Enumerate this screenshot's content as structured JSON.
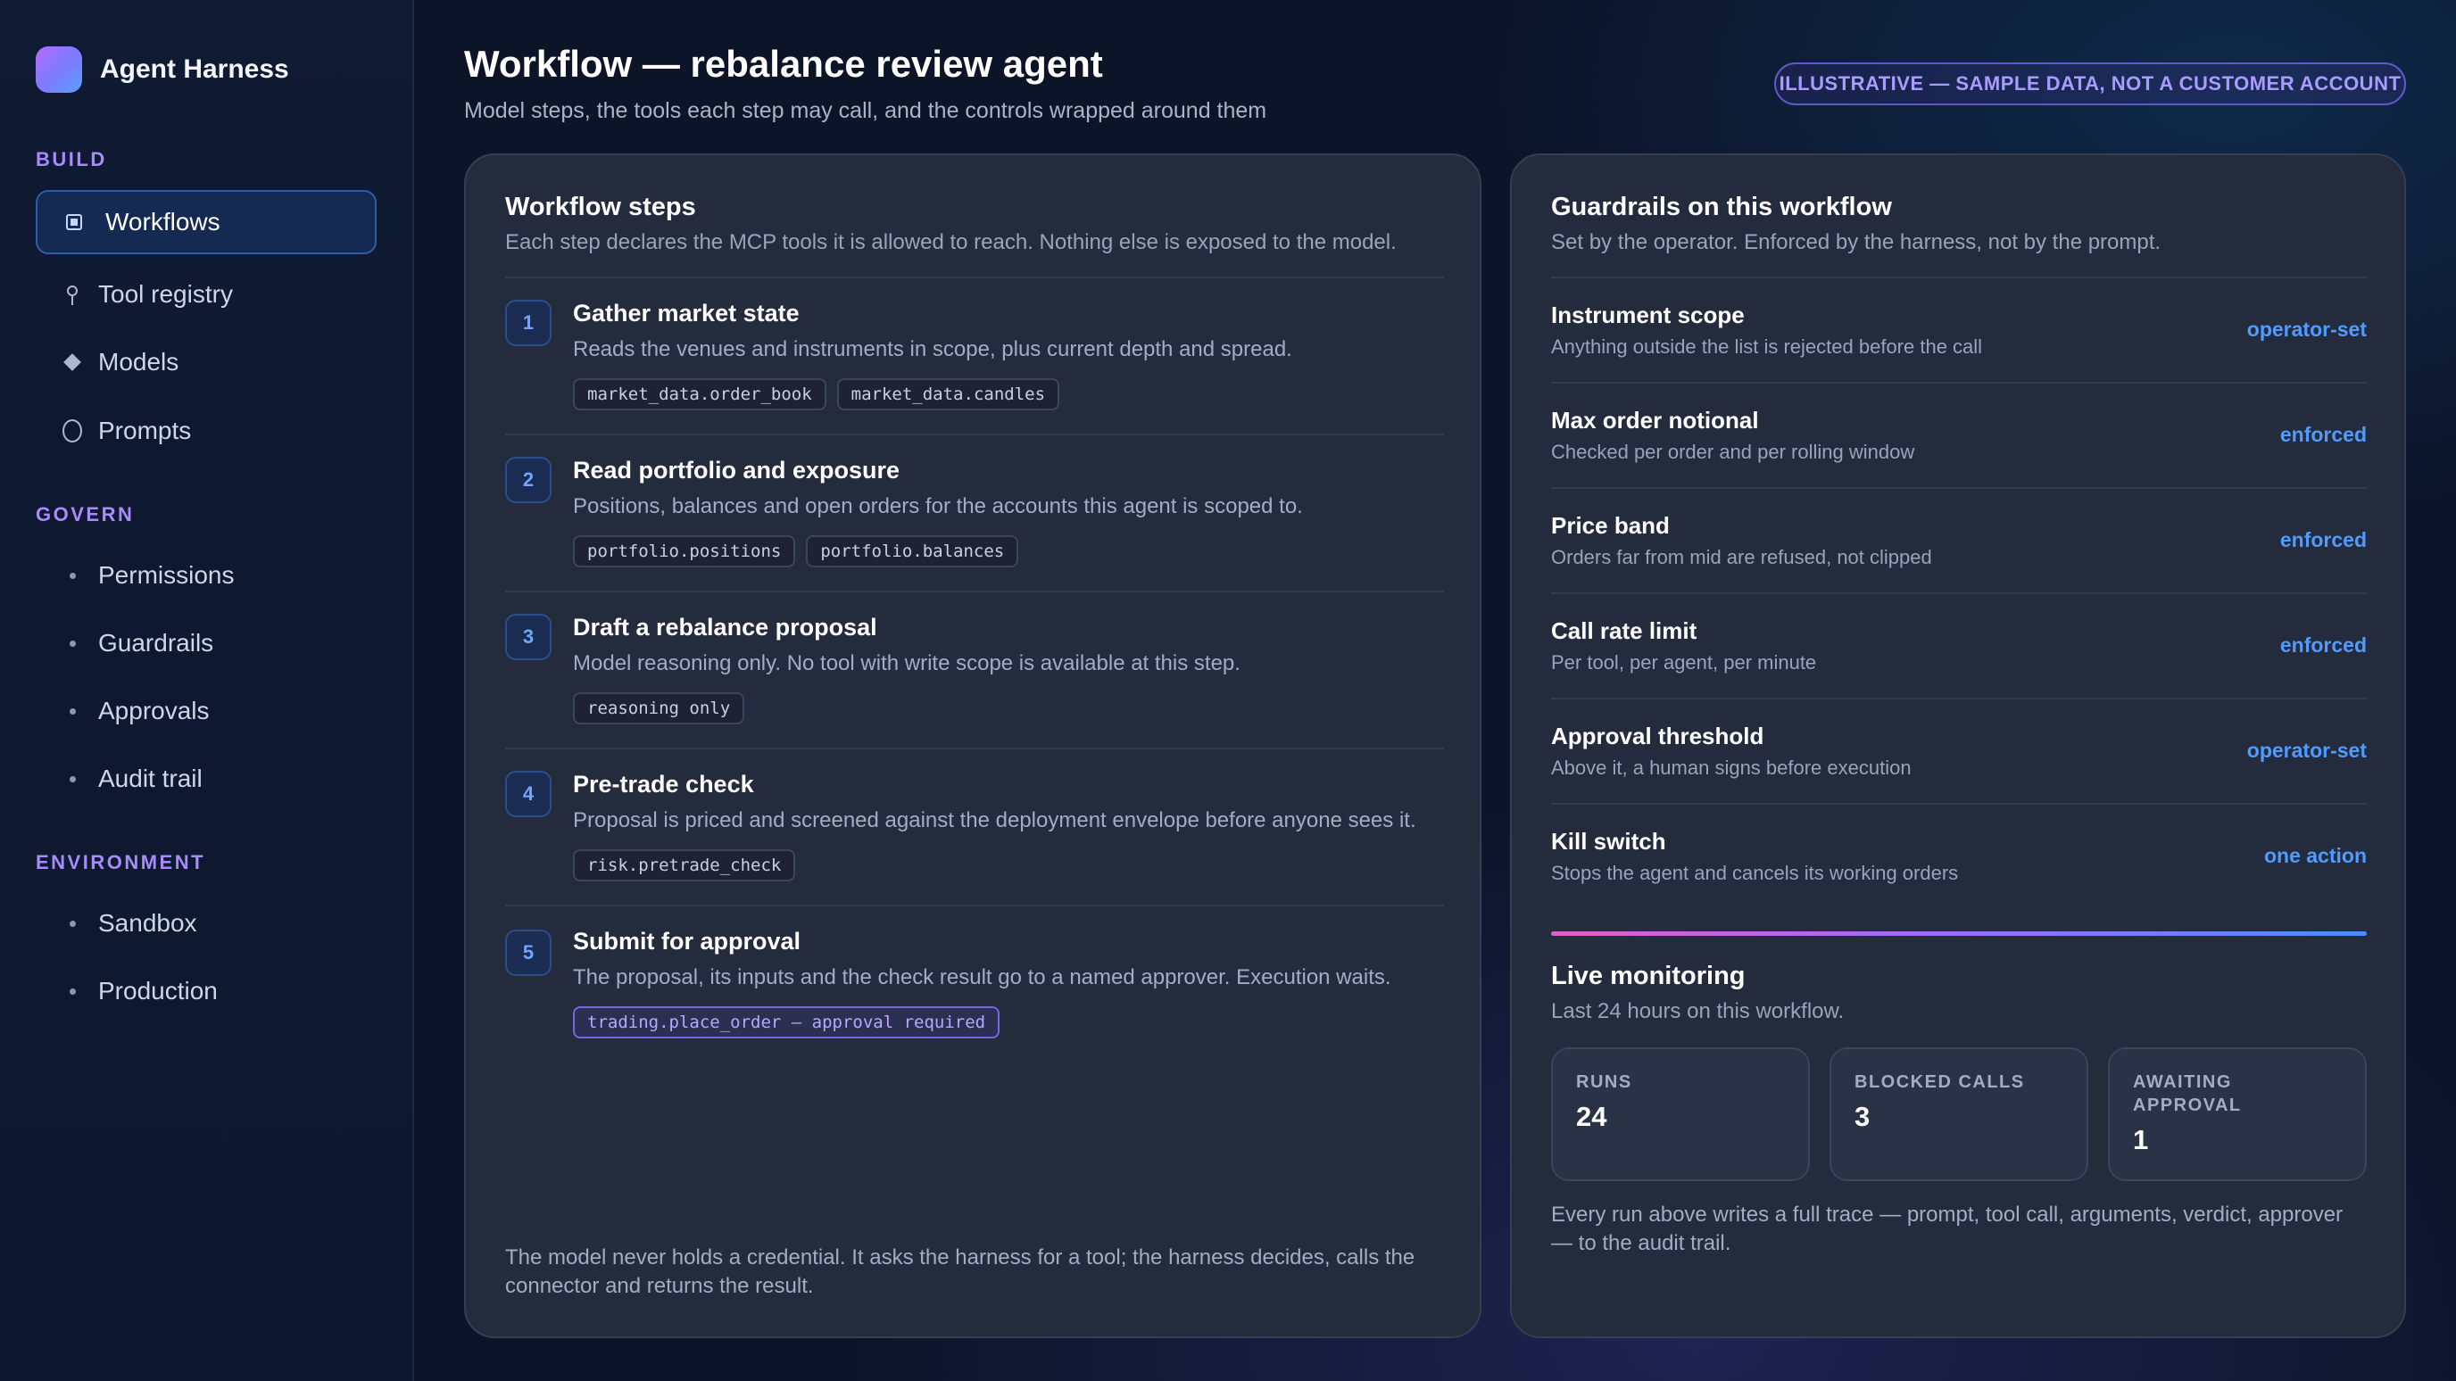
{
  "app": {
    "name": "Agent Harness"
  },
  "sidebar": {
    "sections": [
      {
        "label": "BUILD",
        "items": [
          {
            "label": "Workflows",
            "icon": "workflow-square-icon",
            "active": true
          },
          {
            "label": "Tool registry",
            "icon": "pin-icon"
          },
          {
            "label": "Models",
            "icon": "diamond-icon"
          },
          {
            "label": "Prompts",
            "icon": "circle-icon"
          }
        ]
      },
      {
        "label": "GOVERN",
        "items": [
          {
            "label": "Permissions",
            "icon": "dot-icon"
          },
          {
            "label": "Guardrails",
            "icon": "dot-icon"
          },
          {
            "label": "Approvals",
            "icon": "dot-icon"
          },
          {
            "label": "Audit trail",
            "icon": "dot-icon"
          }
        ]
      },
      {
        "label": "ENVIRONMENT",
        "items": [
          {
            "label": "Sandbox",
            "icon": "dot-icon"
          },
          {
            "label": "Production",
            "icon": "dot-icon"
          }
        ]
      }
    ]
  },
  "header": {
    "title": "Workflow — rebalance review agent",
    "subtitle": "Model steps, the tools each step may call, and the controls wrapped around them",
    "badge": "ILLUSTRATIVE — SAMPLE DATA, NOT A CUSTOMER ACCOUNT"
  },
  "workflow": {
    "title": "Workflow steps",
    "description": "Each step declares the MCP tools it is allowed to reach. Nothing else is exposed to the model.",
    "steps": [
      {
        "number": "1",
        "title": "Gather market state",
        "description": "Reads the venues and instruments in scope, plus current depth and spread.",
        "tools": [
          "market_data.order_book",
          "market_data.candles"
        ]
      },
      {
        "number": "2",
        "title": "Read portfolio and exposure",
        "description": "Positions, balances and open orders for the accounts this agent is scoped to.",
        "tools": [
          "portfolio.positions",
          "portfolio.balances"
        ]
      },
      {
        "number": "3",
        "title": "Draft a rebalance proposal",
        "description": "Model reasoning only. No tool with write scope is available at this step.",
        "tools": [
          "reasoning only"
        ]
      },
      {
        "number": "4",
        "title": "Pre-trade check",
        "description": "Proposal is priced and screened against the deployment envelope before anyone sees it.",
        "tools": [
          "risk.pretrade_check"
        ]
      },
      {
        "number": "5",
        "title": "Submit for approval",
        "description": "The proposal, its inputs and the check result go to a named approver. Execution waits.",
        "tools": [
          "trading.place_order — approval required"
        ]
      }
    ],
    "footer": "The model never holds a credential. It asks the harness for a tool; the harness decides, calls the connector and returns the result."
  },
  "guardrails": {
    "title": "Guardrails on this workflow",
    "description": "Set by the operator. Enforced by the harness, not by the prompt.",
    "items": [
      {
        "title": "Instrument scope",
        "description": "Anything outside the list is rejected before the call",
        "status": "operator-set"
      },
      {
        "title": "Max order notional",
        "description": "Checked per order and per rolling window",
        "status": "enforced"
      },
      {
        "title": "Price band",
        "description": "Orders far from mid are refused, not clipped",
        "status": "enforced"
      },
      {
        "title": "Call rate limit",
        "description": "Per tool, per agent, per minute",
        "status": "enforced"
      },
      {
        "title": "Approval threshold",
        "description": "Above it, a human signs before execution",
        "status": "operator-set"
      },
      {
        "title": "Kill switch",
        "description": "Stops the agent and cancels its working orders",
        "status": "one action"
      }
    ]
  },
  "monitoring": {
    "title": "Live monitoring",
    "description": "Last 24 hours on this workflow.",
    "stats": [
      {
        "label": "RUNS",
        "value": "24"
      },
      {
        "label": "BLOCKED CALLS",
        "value": "3"
      },
      {
        "label": "AWAITING APPROVAL",
        "value": "1"
      }
    ],
    "footer": "Every run above writes a full trace — prompt, tool call, arguments, verdict, approver — to the audit trail."
  }
}
